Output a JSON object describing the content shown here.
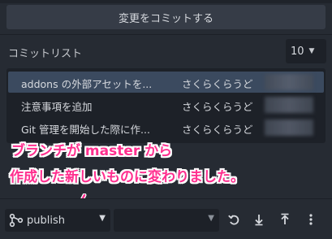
{
  "commit_button": {
    "label": "変更をコミットする"
  },
  "commit_list": {
    "title": "コミットリスト",
    "count": "10",
    "rows": [
      {
        "message": "addons の外部アセットを...",
        "author": "さくらくらうど",
        "selected": true
      },
      {
        "message": "注意事項を追加",
        "author": "さくらくらうど",
        "selected": false
      },
      {
        "message": "Git 管理を開始した際に作...",
        "author": "さくらくらうど",
        "selected": false
      }
    ]
  },
  "annotation": {
    "line1": "ブランチが master から",
    "line2": "作成した新しいものに変わりました。",
    "color": "#ff2f8f"
  },
  "toolbar": {
    "branch": "publish",
    "remote": "",
    "icons": [
      "branch-icon",
      "refresh-icon",
      "pull-icon",
      "push-icon",
      "more-icon"
    ]
  },
  "colors": {
    "background": "#262b33",
    "panel": "#1d2128",
    "button": "#363c47",
    "selection": "#3b4a5f"
  }
}
